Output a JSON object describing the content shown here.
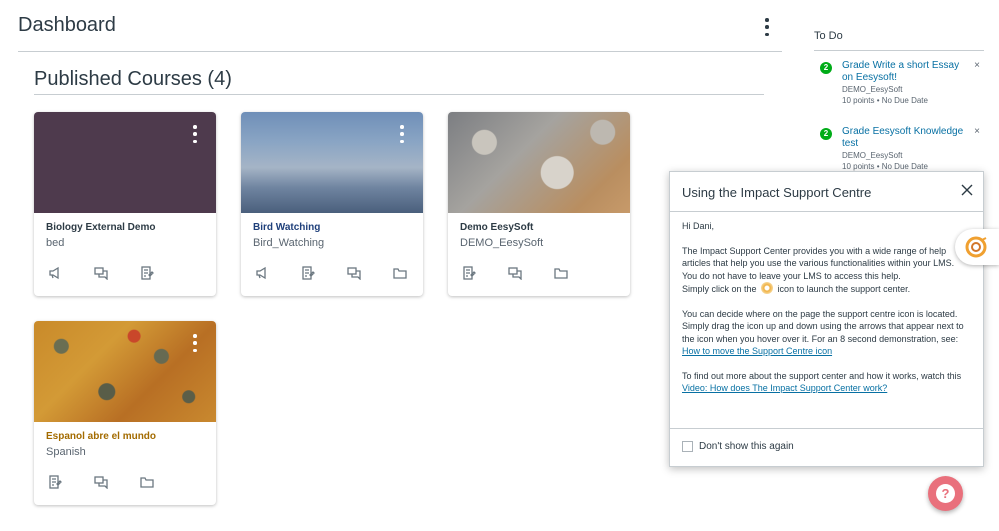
{
  "header": {
    "title": "Dashboard"
  },
  "courses_section": {
    "title": "Published Courses (4)"
  },
  "courses": [
    {
      "name": "Biology External Demo",
      "code": "bed",
      "name_color": "#2d3b45"
    },
    {
      "name": "Bird Watching",
      "code": "Bird_Watching",
      "name_color": "#1e3f7a"
    },
    {
      "name": "Demo EesySoft",
      "code": "DEMO_EesySoft",
      "name_color": "#2d3b45"
    },
    {
      "name": "Espanol abre el mundo",
      "code": "Spanish",
      "name_color": "#a36b00"
    }
  ],
  "todo": {
    "title": "To Do",
    "items": [
      {
        "count": "2",
        "title": "Grade Write a short Essay on Eesysoft!",
        "course": "DEMO_EesySoft",
        "meta": "10 points • No Due Date"
      },
      {
        "count": "2",
        "title": "Grade Eesysoft Knowledge test",
        "course": "DEMO_EesySoft",
        "meta": "10 points • No Due Date"
      }
    ],
    "close_glyph": "×"
  },
  "modal": {
    "title": "Using the Impact Support Centre",
    "greeting": "Hi Dani,",
    "p1": "The Impact Support Center provides you with a wide range of help articles that help you use the various functionalities within your LMS. You do not have to leave your LMS to access this help.",
    "p1b_pre": "Simply click on the",
    "p1b_post": "icon to launch the support center.",
    "p2": "You can decide where on the page the support centre icon is located. Simply drag the icon up and down using the arrows that appear next to the icon when you hover over it. For an 8 second demonstration, see:",
    "p2_link": "How to move the Support Centre icon",
    "p3": "To find out more about the support center and how it works, watch this",
    "p3_link": "Video: How does The Impact Support Center work?",
    "checkbox_label": "Don't show this again"
  },
  "help": {
    "glyph": "?"
  },
  "colors": {
    "link": "#0770a3",
    "badge": "#00ac18",
    "help_fab": "#e9707c",
    "support_accent": "#f0a030"
  }
}
